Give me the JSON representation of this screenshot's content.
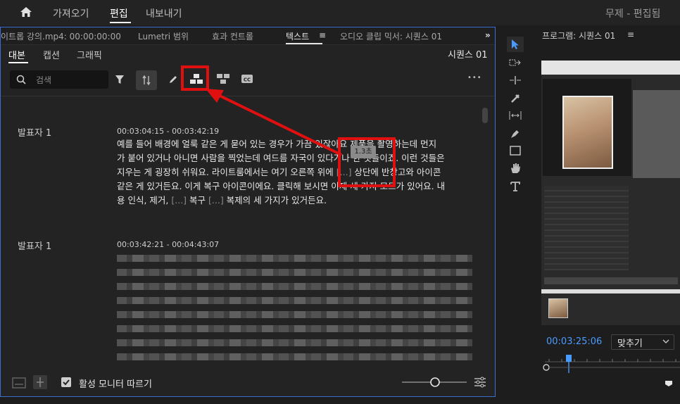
{
  "topbar": {
    "home_icon": "home-icon",
    "nav": [
      "가져오기",
      "편집",
      "내보내기"
    ],
    "project_title": "무제 - 편집됨"
  },
  "panel": {
    "tabs": [
      "이트롭 강의.mp4: 00:00:00:00",
      "Lumetri 범위",
      "효과 컨트롤",
      "텍스트",
      "오디오 클립 믹서: 시퀀스 01"
    ],
    "tab_menu": "≡",
    "overflow": "»",
    "subtabs": [
      "대본",
      "캡션",
      "그래픽"
    ],
    "sequence": "시퀀스 01",
    "search_placeholder": "검색",
    "more": "•••"
  },
  "transcript": [
    {
      "speaker": "발표자 1",
      "timestamp": "00:03:04:15 - 00:03:42:19",
      "lines": [
        "예를 들어 배경에 얼룩 같은 게 묻어 있는 경우가 가끔 있잖아요 제품을 촬영하는데 먼지",
        "가 붙어 있거나 아니면 사람을 찍었는데 여드름 자국이 있다거나 한 것들이죠. 이런 것들은",
        "지우는 게 굉장히 쉬워요. 라이트룸에서는 여기 오른쪽 위에 [...] 상단에 반창고와 아이콘",
        "같은 게 있거든요. 이게 복구 아이콘이에요. 클릭해 보시면 이제 세 가지 모드가 있어요. 내",
        "용 인식, 제거, [...] 복구 [...] 복제의 세 가지가 있거든요."
      ]
    },
    {
      "speaker": "발표자 1",
      "timestamp": "00:03:42:21 - 00:04:43:07"
    }
  ],
  "annotation": {
    "tooltip": "1.3초"
  },
  "bottombar": {
    "follow_label": "활성 모니터 따르기",
    "follow_checked": true
  },
  "program": {
    "title": "프로그램: 시퀀스 01",
    "menu": "≡",
    "timecode": "00:03:25:06",
    "fit": "맞추기"
  },
  "colors": {
    "accent": "#3a6fd0",
    "annotation_red": "#e01010",
    "timecode_blue": "#4a9bff"
  }
}
